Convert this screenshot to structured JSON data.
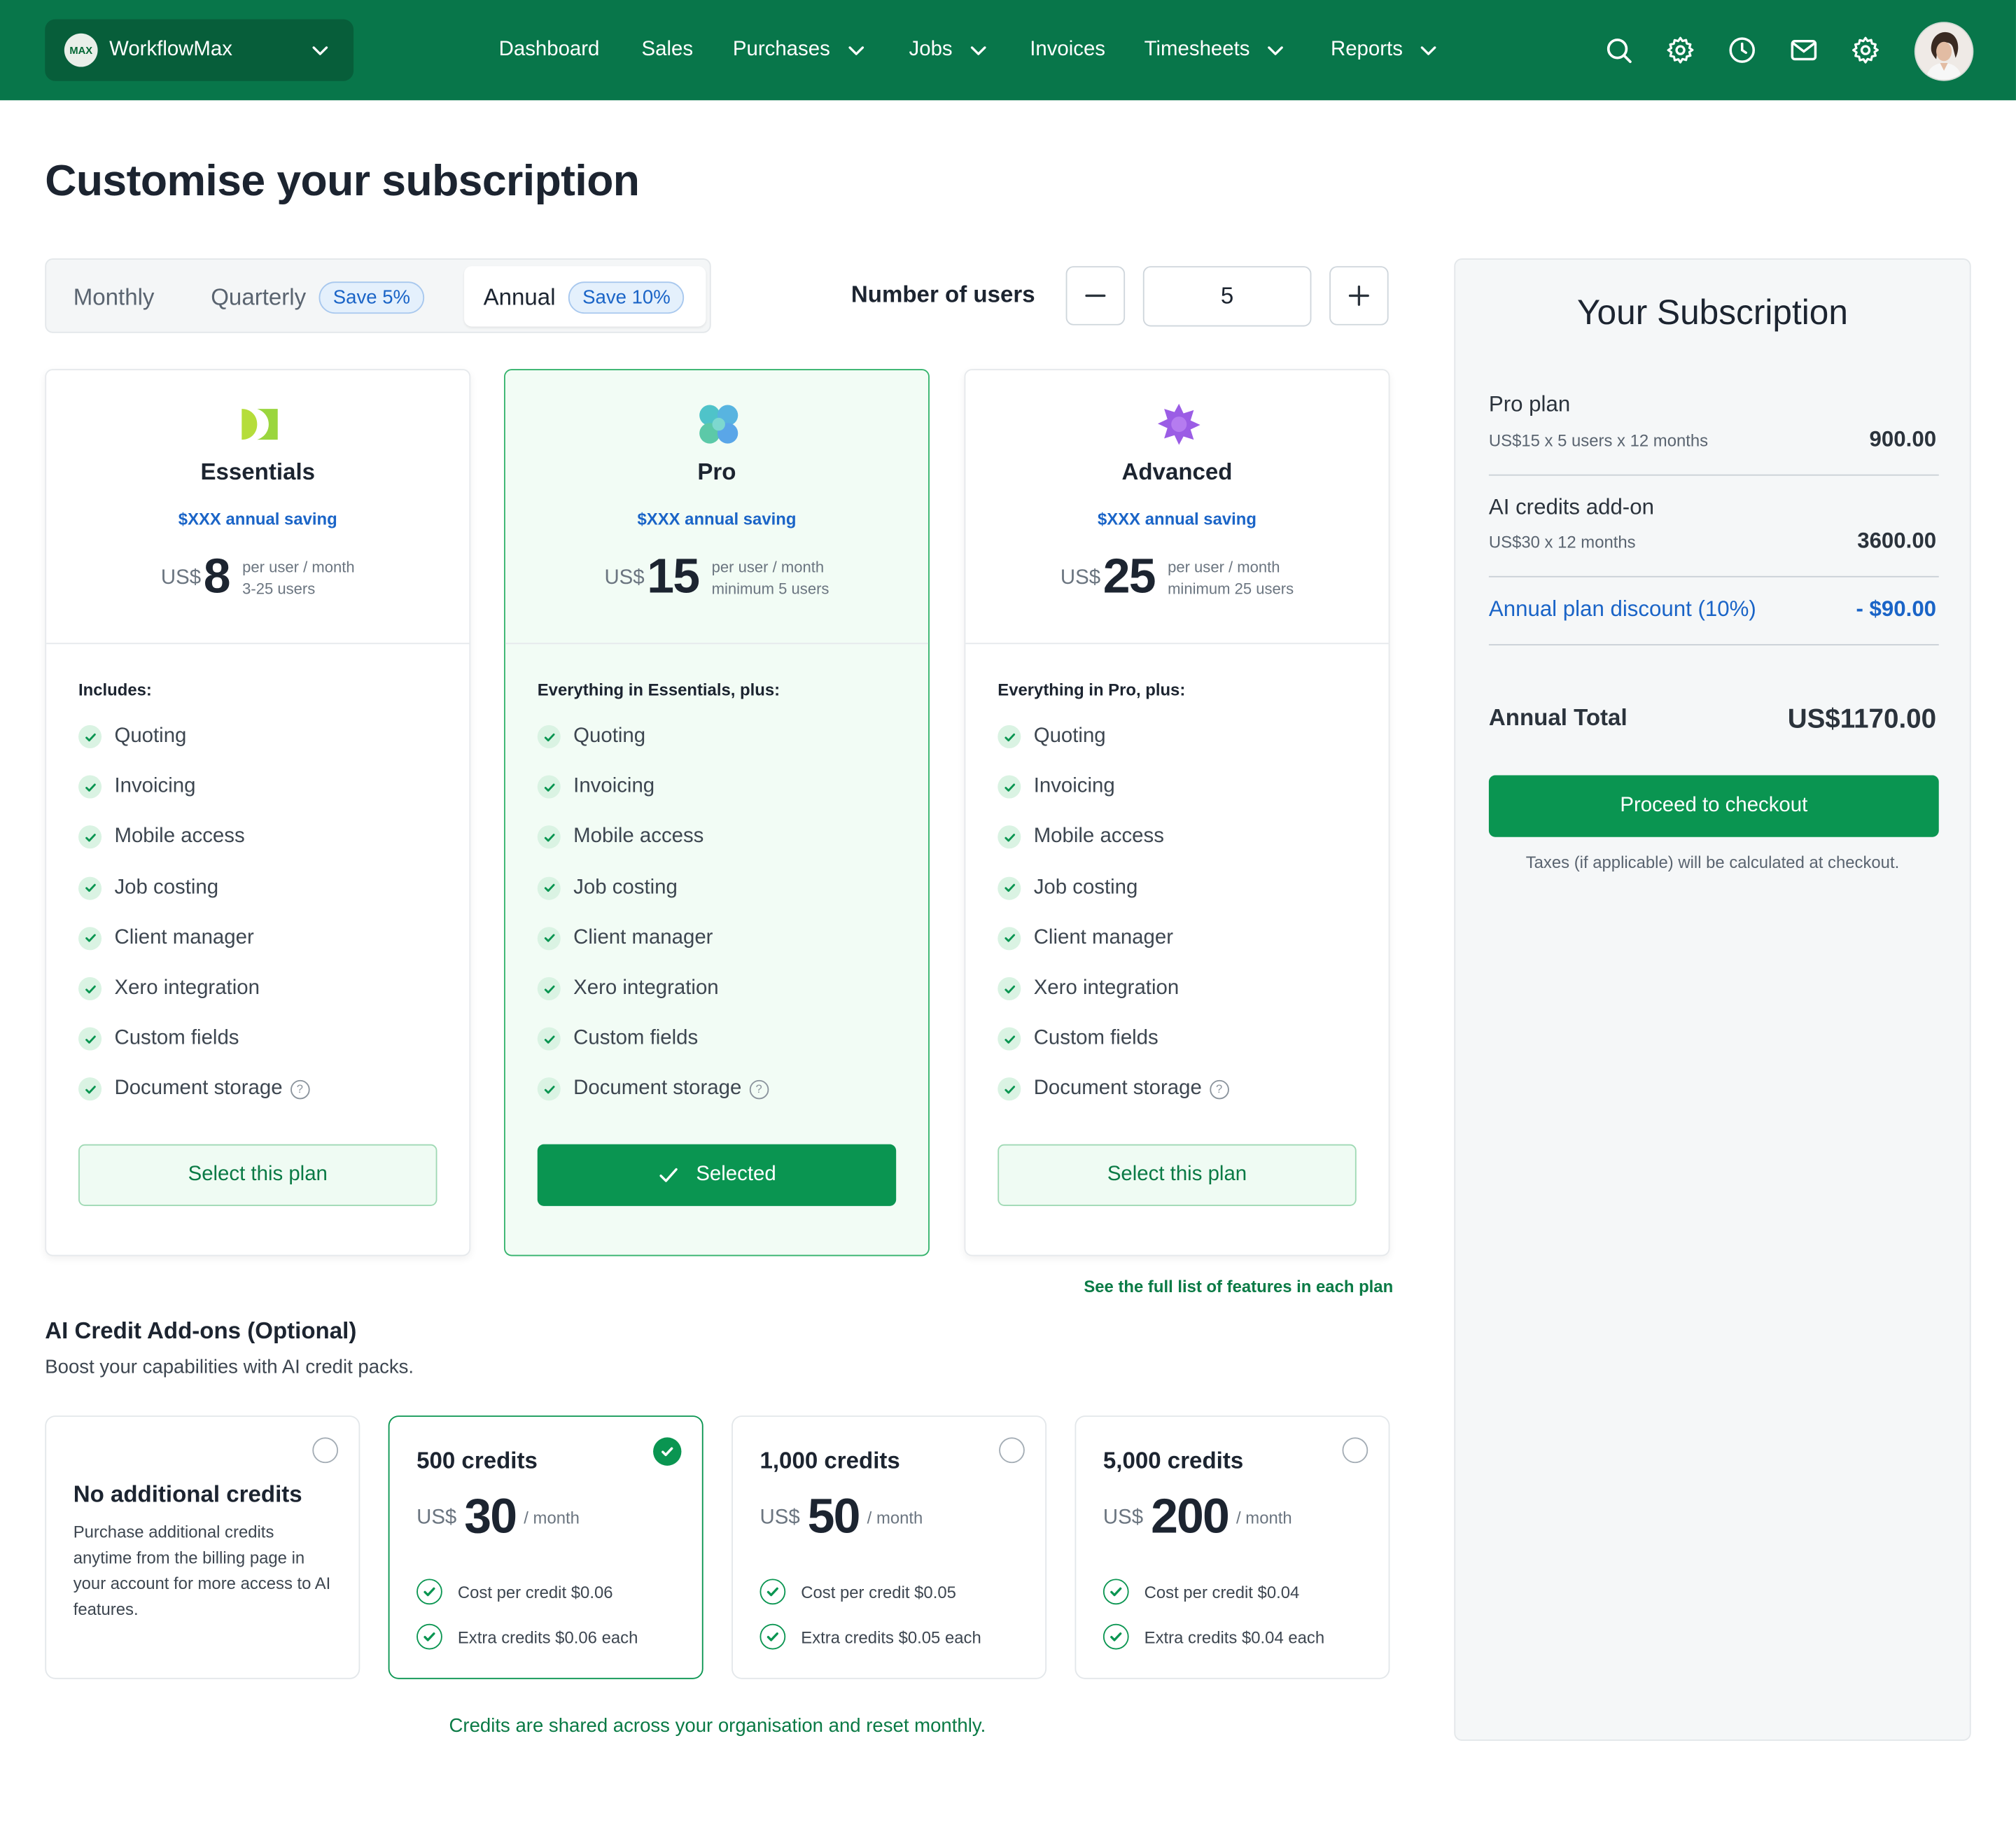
{
  "org": {
    "logo_text": "MAX",
    "name": "WorkflowMax"
  },
  "nav": {
    "dashboard": "Dashboard",
    "sales": "Sales",
    "purchases": "Purchases",
    "jobs": "Jobs",
    "invoices": "Invoices",
    "timesheets": "Timesheets",
    "reports": "Reports"
  },
  "topbar_icons": [
    "search-icon",
    "gear-icon",
    "clock-icon",
    "mail-icon",
    "settings-icon"
  ],
  "page_title": "Customise your subscription",
  "billing": {
    "monthly": "Monthly",
    "quarterly": "Quarterly",
    "quarterly_save": "Save 5%",
    "annual": "Annual",
    "annual_save": "Save 10%",
    "selected": "Annual"
  },
  "users": {
    "label": "Number of users",
    "value": "5"
  },
  "plans": [
    {
      "name": "Essentials",
      "saving": "$XXX annual saving",
      "currency": "US$",
      "price": "8",
      "meta1": "per user / month",
      "meta2": "3-25 users",
      "includes": "Includes:",
      "button": "Select this plan",
      "selected": false
    },
    {
      "name": "Pro",
      "saving": "$XXX annual saving",
      "currency": "US$",
      "price": "15",
      "meta1": "per user / month",
      "meta2": "minimum 5 users",
      "includes": "Everything in Essentials, plus:",
      "button": "Selected",
      "selected": true
    },
    {
      "name": "Advanced",
      "saving": "$XXX annual saving",
      "currency": "US$",
      "price": "25",
      "meta1": "per user / month",
      "meta2": "minimum 25 users",
      "includes": "Everything in Pro, plus:",
      "button": "Select this plan",
      "selected": false
    }
  ],
  "features": [
    "Quoting",
    "Invoicing",
    "Mobile access",
    "Job costing",
    "Client manager",
    "Xero integration",
    "Custom fields",
    "Document storage"
  ],
  "full_list_link": "See the full list of features in each plan",
  "addons": {
    "title": "AI Credit Add-ons (Optional)",
    "subtitle": "Boost your capabilities with AI credit packs.",
    "none": {
      "title": "No additional credits",
      "desc": "Purchase additional credits anytime from the billing page in your account for more access to AI features."
    },
    "packs": [
      {
        "title": "500 credits",
        "currency": "US$",
        "price": "30",
        "per": "/ month",
        "line1": "Cost per credit $0.06",
        "line2": "Extra credits $0.06 each",
        "selected": true
      },
      {
        "title": "1,000 credits",
        "currency": "US$",
        "price": "50",
        "per": "/ month",
        "line1": "Cost per credit $0.05",
        "line2": "Extra credits $0.05 each",
        "selected": false
      },
      {
        "title": "5,000 credits",
        "currency": "US$",
        "price": "200",
        "per": "/ month",
        "line1": "Cost per credit $0.04",
        "line2": "Extra credits $0.04 each",
        "selected": false
      }
    ],
    "note": "Credits are shared across your organisation and reset monthly."
  },
  "summary": {
    "title": "Your Subscription",
    "plan_label": "Pro plan",
    "plan_sub": "US$15 x 5 users x 12 months",
    "plan_value": "900.00",
    "ai_label": "AI credits add-on",
    "ai_sub": "US$30 x 12 months",
    "ai_value": "3600.00",
    "discount_label": "Annual plan discount (10%)",
    "discount_value": "- $90.00",
    "total_label": "Annual Total",
    "total_value": "US$1170.00",
    "checkout": "Proceed to checkout",
    "taxes": "Taxes (if applicable) will be calculated at checkout."
  },
  "colors": {
    "brand": "#08764a",
    "accent": "#0a9551",
    "link": "#1a64c7"
  }
}
